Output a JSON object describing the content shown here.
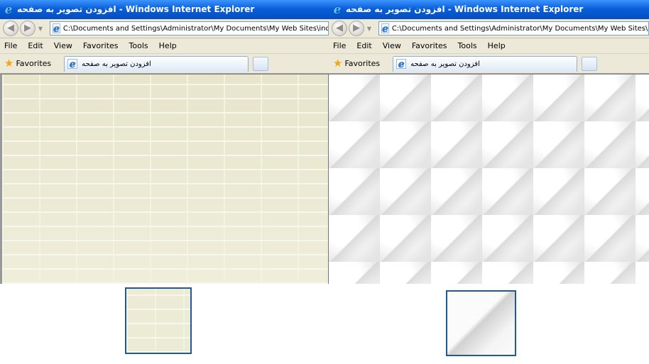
{
  "windows": [
    {
      "title": "افزودن تصویر به صفحه - Windows Internet Explorer",
      "address": "C:\\Documents and Settings\\Administrator\\My Documents\\My Web Sites\\index.htm",
      "menu": [
        "File",
        "Edit",
        "View",
        "Favorites",
        "Tools",
        "Help"
      ],
      "favorites_label": "Favorites",
      "tab_title": "افزودن تصویر به صفحه",
      "background_pattern": "beige-brick"
    },
    {
      "title": "افزودن تصویر به صفحه - Windows Internet Explorer",
      "address": "C:\\Documents and Settings\\Administrator\\My Documents\\My Web Sites\\index.htm",
      "menu": [
        "File",
        "Edit",
        "View",
        "Favorites",
        "Tools",
        "Help"
      ],
      "favorites_label": "Favorites",
      "tab_title": "افزودن تصویر به صفحه",
      "background_pattern": "white-pyramid-tiles"
    }
  ],
  "icons": {
    "browser": "ie-logo-icon",
    "back": "back-arrow-icon",
    "forward": "forward-arrow-icon",
    "favorites": "star-icon"
  },
  "colors": {
    "titlebar": "#0453c9",
    "swatch_border": "#1f5b92",
    "brick_background": "#ecebd6"
  }
}
